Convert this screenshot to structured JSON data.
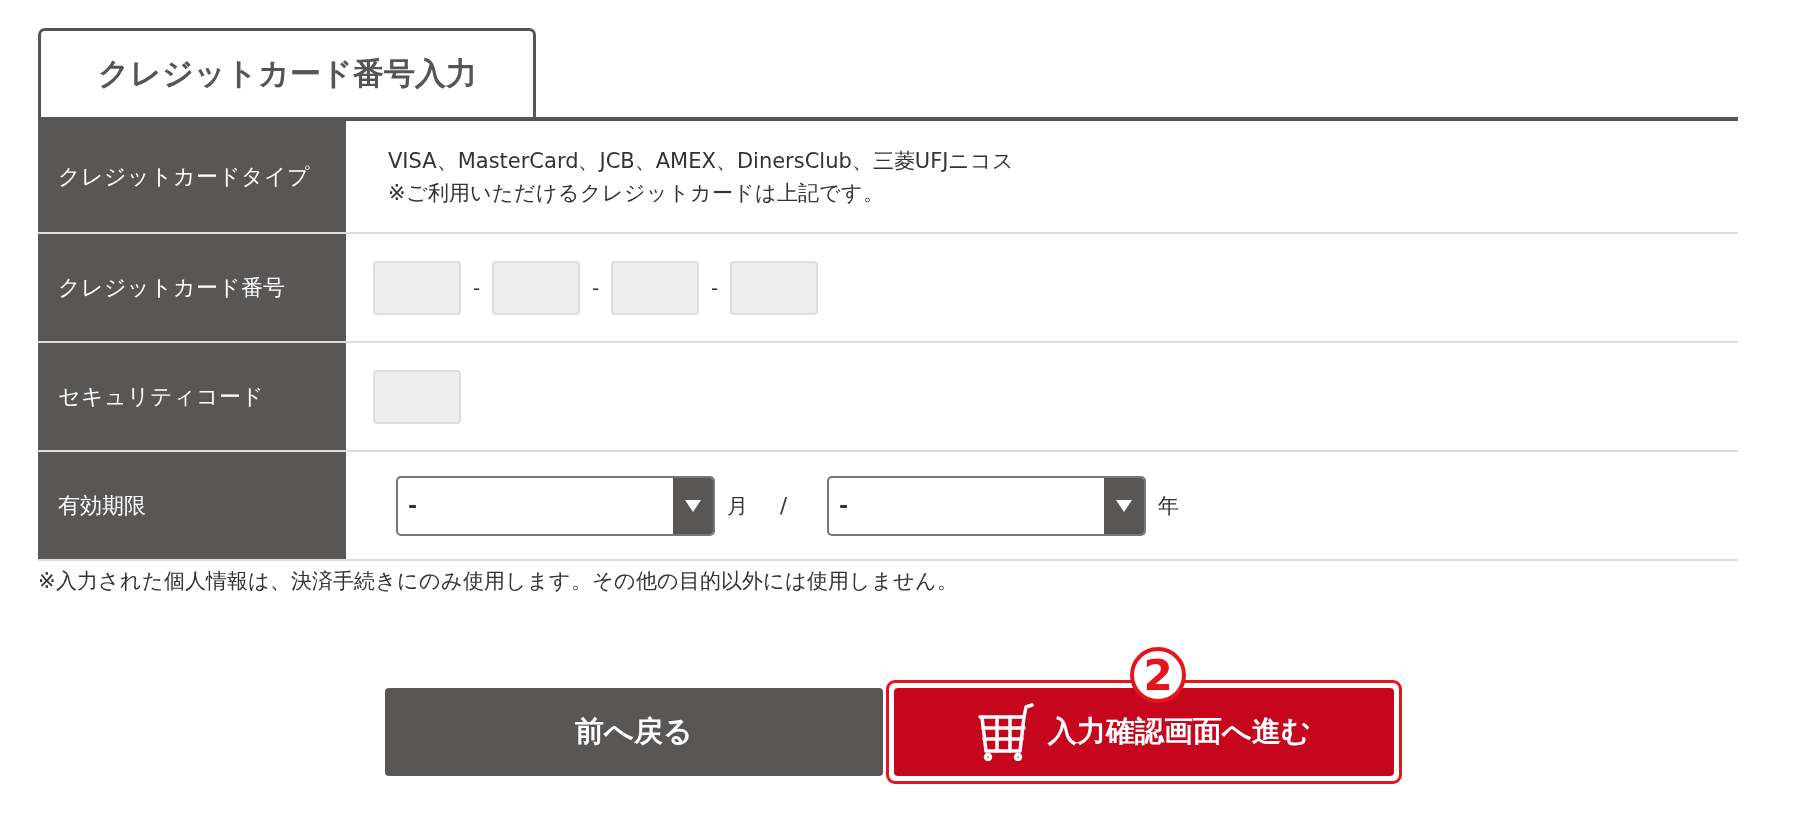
{
  "tab": {
    "label": "クレジットカード番号入力",
    "selected": true
  },
  "rows": [
    {
      "kind": "text",
      "label": "クレジットカードタイプ",
      "lines": [
        "VISA、MasterCard、JCB、AMEX、DinersClub、三菱UFJニコス",
        "※ご利用いただけるクレジットカードは上記です。"
      ]
    },
    {
      "kind": "card_number",
      "label": "クレジットカード番号",
      "fields": [
        {
          "kind": "input"
        },
        {
          "kind": "input"
        },
        {
          "kind": "input"
        },
        {
          "kind": "input"
        }
      ],
      "separators": [
        "-",
        "-",
        "-"
      ]
    },
    {
      "kind": "code",
      "label": "セキュリティコード",
      "fields": [
        {
          "kind": "input"
        }
      ]
    },
    {
      "kind": "expiry",
      "label": "有効期限",
      "selects": [
        {
          "value": "-",
          "unit": "月"
        },
        {
          "value": "-",
          "unit": "年"
        }
      ],
      "separator": "/"
    }
  ],
  "note": "※入力された個人情報は、決済手続きにのみ使用します。その他の目的以外には使用しません。",
  "buttons": [
    {
      "kind": "back",
      "label": "前へ戻る"
    },
    {
      "kind": "next",
      "label": "入力確認画面へ進む",
      "step": "2"
    }
  ]
}
